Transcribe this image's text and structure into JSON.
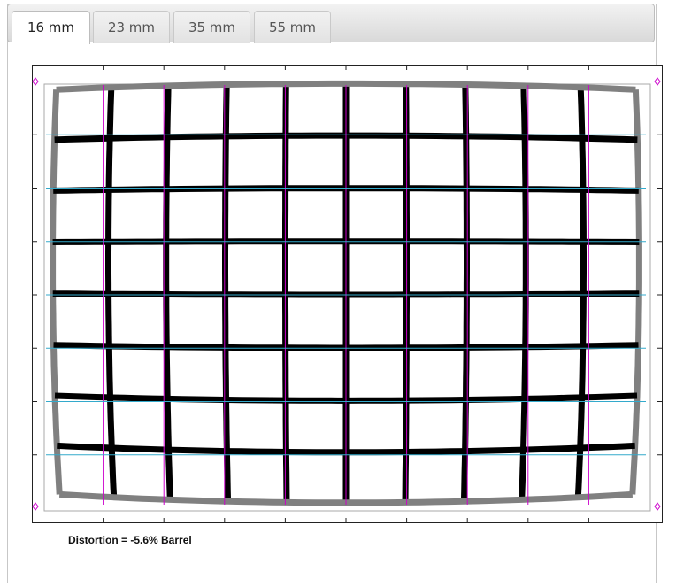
{
  "tabs": [
    {
      "label": "16 mm",
      "active": true
    },
    {
      "label": "23 mm",
      "active": false
    },
    {
      "label": "35 mm",
      "active": false
    },
    {
      "label": "55 mm",
      "active": false
    }
  ],
  "chart_data": {
    "type": "distortion-grid",
    "focal_length": "16 mm",
    "distortion_percent": -5.6,
    "distortion_type": "Barrel",
    "grid_columns": 10,
    "grid_rows": 8,
    "colors": {
      "grid": "#000000",
      "border": "#808080",
      "reference_vertical": "#cc00cc",
      "reference_horizontal": "#33aacc"
    }
  },
  "caption": "Distortion = -5.6% Barrel"
}
